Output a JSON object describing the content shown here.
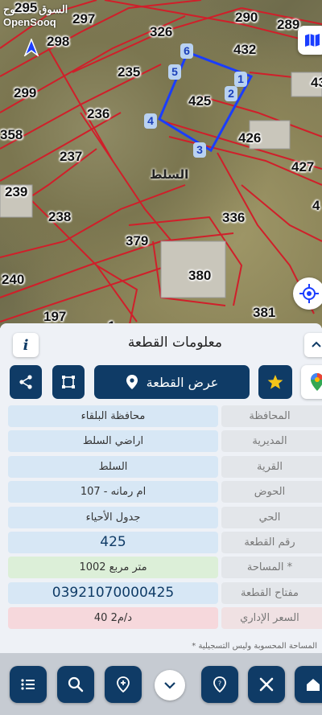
{
  "branding": {
    "arabic_name": "السوق المفتوح",
    "english_name": "OpenSooq"
  },
  "map": {
    "parcel_numbers": [
      "295",
      "297",
      "290",
      "289",
      "298",
      "326",
      "432",
      "235",
      "43",
      "299",
      "425",
      "236",
      "426",
      "358",
      "237",
      "427",
      "239",
      "238",
      "336",
      "379",
      "380",
      "240",
      "197",
      "381",
      "4",
      "1__"
    ],
    "vertex_labels": [
      "1",
      "2",
      "3",
      "4",
      "5",
      "6"
    ],
    "road_name": "السلط",
    "colors": {
      "boundary": "#d01f2a",
      "selected_parcel": "#1a3dff",
      "vertex_badge": "#b9d2f2"
    }
  },
  "panel": {
    "title": "معلومات القطعة",
    "show_parcel_label": "عرض القطعة",
    "rows": [
      {
        "label": "المحافظة",
        "value": "محافظة البلقاء"
      },
      {
        "label": "المديرية",
        "value": "اراضي السلط"
      },
      {
        "label": "القرية",
        "value": "السلط"
      },
      {
        "label": "الحوض",
        "value": "ام رمانه - 107"
      },
      {
        "label": "الحي",
        "value": "جدول الأحياء"
      },
      {
        "label": "رقم القطعة",
        "value": "425"
      },
      {
        "label": "المساحة *",
        "value": "1002   متر مربع"
      },
      {
        "label": "مفتاح القطعة",
        "value": "03921070000425"
      },
      {
        "label": "السعر الإداري",
        "value": "40 د/م2"
      }
    ],
    "footnote": "* المساحة المحسوبة وليس التسجيلية"
  },
  "bottom_nav": {
    "items": [
      "list-icon",
      "search-icon",
      "pin-icon",
      "chevron-down-icon",
      "help-pin-icon",
      "tools-icon",
      "home-icon"
    ]
  },
  "colors": {
    "primary": "#0f3b66",
    "info_row": "#d7e7f5",
    "area_row": "#dcefd8",
    "price_row": "#f6d8dc"
  }
}
